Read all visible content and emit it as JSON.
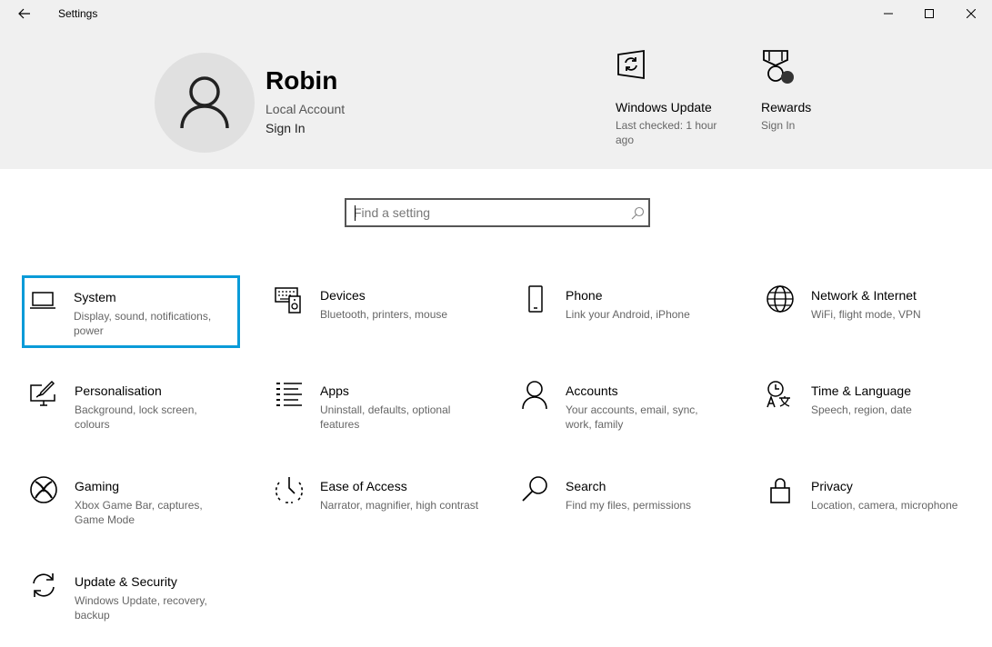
{
  "window": {
    "title": "Settings",
    "back_icon": "back-arrow-icon",
    "minimize_icon": "minimize-icon",
    "maximize_icon": "maximize-icon",
    "close_icon": "close-icon"
  },
  "profile": {
    "name": "Robin",
    "account_type": "Local Account",
    "sign_in": "Sign In",
    "avatar_icon": "person-icon"
  },
  "header_tiles": [
    {
      "title": "Windows Update",
      "subtitle": "Last checked: 1 hour ago",
      "icon": "windows-update-icon"
    },
    {
      "title": "Rewards",
      "subtitle": "Sign In",
      "icon": "rewards-medal-icon"
    }
  ],
  "search": {
    "placeholder": "Find a setting",
    "icon": "search-icon"
  },
  "categories": [
    {
      "label": "System",
      "description": "Display, sound, notifications, power",
      "icon": "laptop-icon",
      "selected": true
    },
    {
      "label": "Devices",
      "description": "Bluetooth, printers, mouse",
      "icon": "keyboard-speaker-icon"
    },
    {
      "label": "Phone",
      "description": "Link your Android, iPhone",
      "icon": "phone-icon"
    },
    {
      "label": "Network & Internet",
      "description": "WiFi, flight mode, VPN",
      "icon": "globe-icon"
    },
    {
      "label": "Personalisation",
      "description": "Background, lock screen, colours",
      "icon": "paint-screen-icon"
    },
    {
      "label": "Apps",
      "description": "Uninstall, defaults, optional features",
      "icon": "apps-list-icon"
    },
    {
      "label": "Accounts",
      "description": "Your accounts, email, sync, work, family",
      "icon": "person-icon"
    },
    {
      "label": "Time & Language",
      "description": "Speech, region, date",
      "icon": "time-language-icon"
    },
    {
      "label": "Gaming",
      "description": "Xbox Game Bar, captures, Game Mode",
      "icon": "xbox-icon"
    },
    {
      "label": "Ease of Access",
      "description": "Narrator, magnifier, high contrast",
      "icon": "ease-of-access-icon"
    },
    {
      "label": "Search",
      "description": "Find my files, permissions",
      "icon": "search-icon"
    },
    {
      "label": "Privacy",
      "description": "Location, camera, microphone",
      "icon": "lock-icon"
    },
    {
      "label": "Update & Security",
      "description": "Windows Update, recovery, backup",
      "icon": "sync-arrows-icon"
    }
  ],
  "colors": {
    "header_bg": "#f0f0f0",
    "selection_border": "#0a9bd8",
    "description_text": "#666666"
  }
}
